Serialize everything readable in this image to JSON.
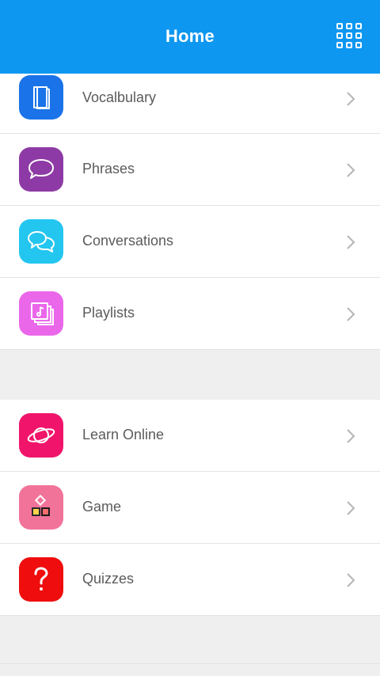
{
  "header": {
    "title": "Home",
    "background": "#0e97f1",
    "menu_icon": "grid-icon"
  },
  "sections": [
    {
      "items": [
        {
          "label": "Vocalbulary",
          "icon": "book-icon",
          "color": "#1a73e8"
        },
        {
          "label": "Phrases",
          "icon": "speech-bubble-icon",
          "color": "#8e3aa6"
        },
        {
          "label": "Conversations",
          "icon": "chat-bubbles-icon",
          "color": "#23c6ef"
        },
        {
          "label": "Playlists",
          "icon": "music-playlist-icon",
          "color": "#ea67ea"
        }
      ]
    },
    {
      "items": [
        {
          "label": "Learn Online",
          "icon": "planet-icon",
          "color": "#f0156a"
        },
        {
          "label": "Game",
          "icon": "shapes-icon",
          "color": "#f2739a"
        },
        {
          "label": "Quizzes",
          "icon": "question-icon",
          "color": "#f00d0d"
        }
      ]
    }
  ]
}
